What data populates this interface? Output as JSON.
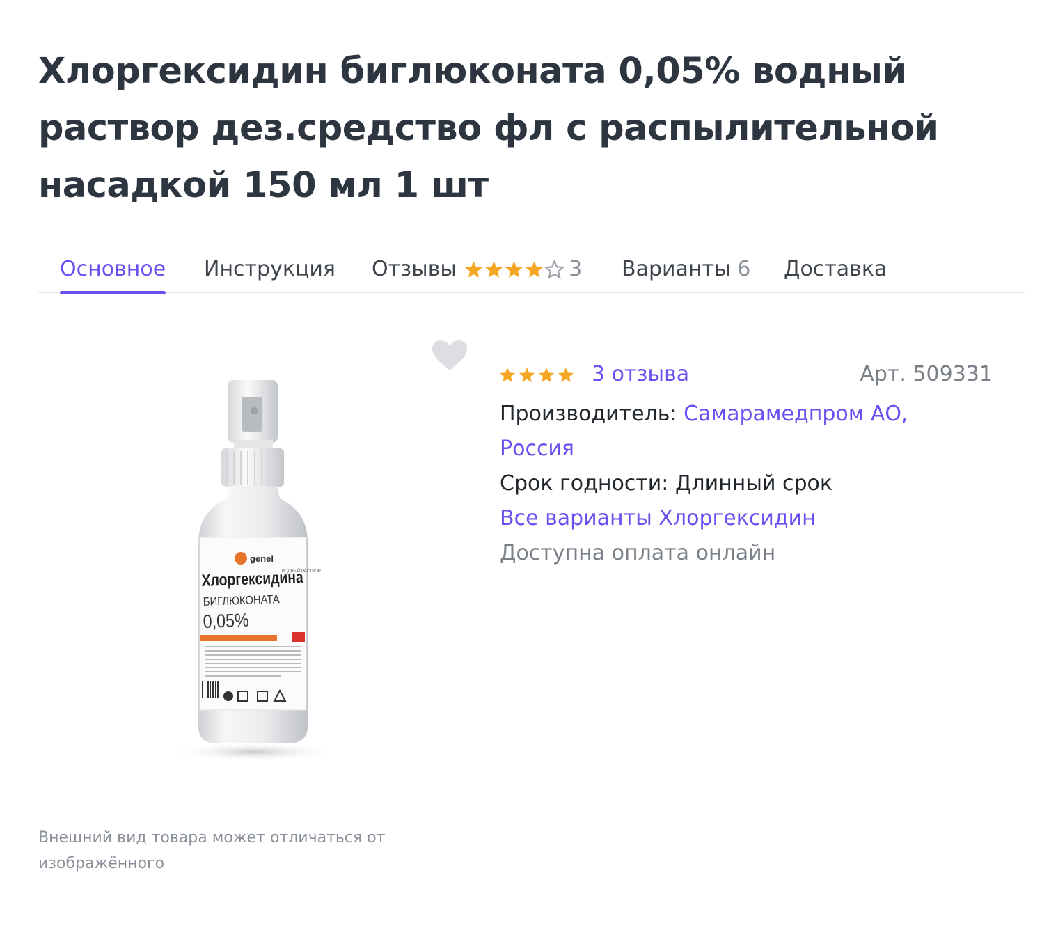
{
  "product": {
    "title": "Хлоргексидин биглюконата 0,05% водный раствор дез.средство фл с распылительной насадкой 150 мл 1 шт"
  },
  "tabs": [
    {
      "label": "Основное",
      "count": "",
      "active": true
    },
    {
      "label": "Инструкция",
      "count": "",
      "active": false
    },
    {
      "label": "Отзывы",
      "count": "3",
      "rating": 4,
      "active": false
    },
    {
      "label": "Варианты",
      "count": "6",
      "active": false
    },
    {
      "label": "Доставка",
      "count": "",
      "active": false
    }
  ],
  "rating": {
    "stars": 4,
    "max": 5,
    "reviews_label": "3 отзыва"
  },
  "article": "Арт. 509331",
  "info": {
    "manufacturer_label": "Производитель:",
    "manufacturer_value": "Самарамедпром АО, Россия",
    "expiry_label": "Срок годности:",
    "expiry_value": "Длинный срок",
    "variants_link": "Все варианты Хлоргексидин",
    "payment_note": "Доступна оплата онлайн"
  },
  "image_label": {
    "brand": "genel",
    "type": "ВОДНЫЙ РАСТВОР",
    "name_line1": "Хлоргексидина",
    "name_line2": "БИГЛЮКОНАТА",
    "concentration": "0,05%"
  },
  "disclaimer": "Внешний вид товара может отличаться от изображённого",
  "colors": {
    "accent": "#6b4ff0",
    "star": "#f5a623",
    "star_empty": "#9aa0a8",
    "label_orange": "#e8742c"
  },
  "icons": {
    "favorite": "heart-icon",
    "rating": "star-icon"
  }
}
